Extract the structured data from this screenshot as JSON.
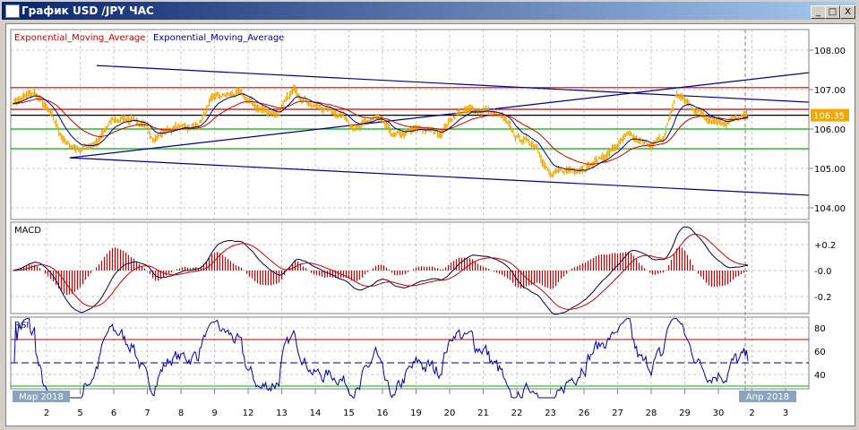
{
  "window": {
    "title": "График USD /JPY  ЧАС",
    "minimize": "_",
    "maximize": "□",
    "close": "X"
  },
  "legend": {
    "ema_slow": "Exponential_Moving_Average",
    "ema_fast": "Exponential_Moving_Average"
  },
  "colors": {
    "price": "#f0a800",
    "ema_slow": "#cc0000",
    "ema_fast": "#000080",
    "trend": "#000090",
    "last_price_bg": "#f0a800"
  },
  "last_price": "106.35",
  "price_axis": [
    "108.00",
    "107.00",
    "106.00",
    "105.00",
    "104.00"
  ],
  "macd": {
    "title": "MACD",
    "axis": [
      "+0.2",
      "-0.0",
      "-0.2"
    ]
  },
  "rsi": {
    "title": "RSI",
    "axis": [
      "80",
      "60",
      "40"
    ]
  },
  "month_labels": {
    "start": "Мар 2018",
    "end": "Апр 2018"
  },
  "x_ticks": [
    "2",
    "5",
    "6",
    "7",
    "8",
    "9",
    "12",
    "13",
    "14",
    "15",
    "16",
    "19",
    "20",
    "21",
    "22",
    "23",
    "26",
    "27",
    "28",
    "29",
    "30",
    "2",
    "3"
  ],
  "chart_data": {
    "type": "line",
    "price_path": [
      [
        -1,
        106.7
      ],
      [
        -0.35,
        106.9
      ],
      [
        0.08,
        106.4
      ],
      [
        0.6,
        105.6
      ],
      [
        1,
        105.5
      ],
      [
        1.55,
        105.7
      ],
      [
        1.95,
        106.2
      ],
      [
        2.6,
        106.3
      ],
      [
        3.15,
        105.8
      ],
      [
        3.7,
        106.0
      ],
      [
        4.5,
        106.1
      ],
      [
        5.0,
        106.8
      ],
      [
        5.7,
        106.9
      ],
      [
        6.35,
        106.5
      ],
      [
        6.9,
        106.4
      ],
      [
        7.4,
        107.0
      ],
      [
        7.95,
        106.6
      ],
      [
        8.75,
        106.4
      ],
      [
        9.3,
        106.0
      ],
      [
        9.8,
        106.3
      ],
      [
        10.35,
        105.8
      ],
      [
        11.15,
        106.0
      ],
      [
        11.7,
        105.9
      ],
      [
        12.2,
        106.4
      ],
      [
        13.0,
        106.5
      ],
      [
        13.55,
        106.3
      ],
      [
        13.95,
        105.8
      ],
      [
        14.6,
        105.6
      ],
      [
        15.0,
        104.8
      ],
      [
        15.7,
        105.0
      ],
      [
        16.2,
        105.1
      ],
      [
        16.75,
        105.4
      ],
      [
        17.3,
        105.8
      ],
      [
        17.8,
        105.6
      ],
      [
        18.35,
        105.7
      ],
      [
        18.75,
        106.9
      ],
      [
        19.15,
        106.6
      ],
      [
        19.7,
        106.3
      ],
      [
        20.2,
        106.2
      ],
      [
        20.9,
        106.3
      ]
    ],
    "horizontal_levels": [
      {
        "price": 107.05,
        "color": "#cc0000"
      },
      {
        "price": 106.5,
        "color": "#cc0000"
      },
      {
        "price": 106.35,
        "color": "#000000"
      },
      {
        "price": 106.0,
        "color": "#00b000"
      },
      {
        "price": 105.5,
        "color": "#00b000"
      }
    ],
    "trendlines": [
      [
        [
          1.49,
          107.61
        ],
        [
          22.7,
          106.68
        ]
      ],
      [
        [
          0.69,
          105.27
        ],
        [
          22.7,
          107.43
        ]
      ],
      [
        [
          0.69,
          105.27
        ],
        [
          22.7,
          104.32
        ]
      ]
    ],
    "ylim": [
      103.7,
      108.5
    ],
    "rsi_levels": [
      70,
      30
    ],
    "current_time_index": 20.8
  }
}
